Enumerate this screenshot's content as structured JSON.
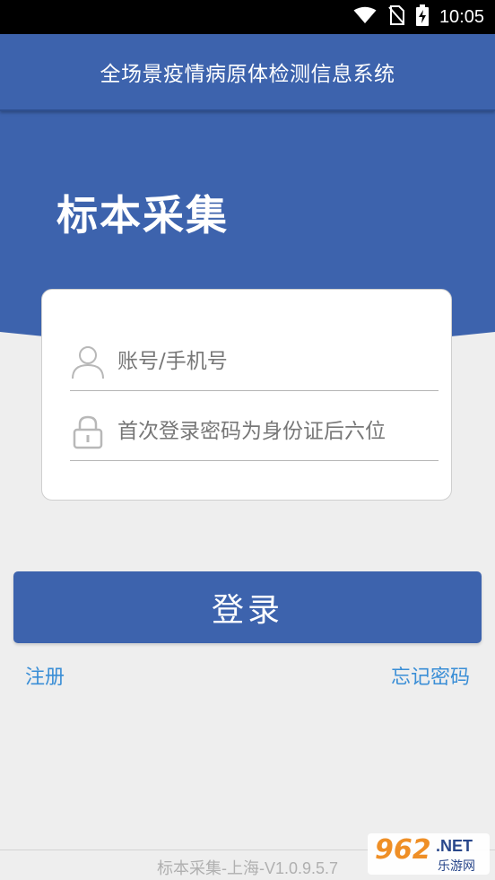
{
  "status_bar": {
    "time": "10:05",
    "icons": [
      "wifi-icon",
      "no-sim-icon",
      "battery-charging-icon"
    ]
  },
  "app_bar": {
    "title": "全场景疫情病原体检测信息系统"
  },
  "hero": {
    "title": "标本采集"
  },
  "form": {
    "account_placeholder": "账号/手机号",
    "password_placeholder": "首次登录密码为身份证后六位",
    "account_icon": "user-icon",
    "password_icon": "lock-icon"
  },
  "actions": {
    "login_label": "登录",
    "register_label": "注册",
    "forgot_label": "忘记密码"
  },
  "footer": {
    "version": "标本采集-上海-V1.0.9.5.7"
  },
  "watermark": {
    "number": "962",
    "net": ".NET",
    "site": "乐游网"
  },
  "colors": {
    "primary": "#3d63ad",
    "link": "#3a8ed6",
    "background": "#eeeeee"
  }
}
